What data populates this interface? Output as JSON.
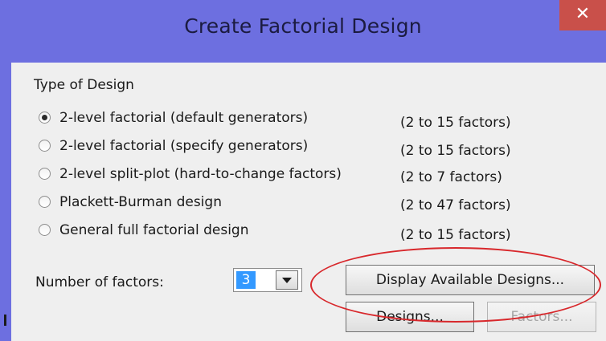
{
  "window": {
    "title": "Create Factorial Design",
    "close_glyph": "✕"
  },
  "design_type": {
    "label": "Type of Design",
    "options": [
      {
        "label": "2-level factorial (default generators)",
        "range": "(2 to 15 factors)",
        "selected": true
      },
      {
        "label": "2-level factorial (specify generators)",
        "range": "(2 to 15 factors)",
        "selected": false
      },
      {
        "label": "2-level split-plot (hard-to-change factors)",
        "range": "(2 to 7 factors)",
        "selected": false
      },
      {
        "label": "Plackett-Burman design",
        "range": "(2 to 47 factors)",
        "selected": false
      },
      {
        "label": "General full factorial design",
        "range": "(2 to 15 factors)",
        "selected": false
      }
    ]
  },
  "number_of_factors": {
    "label": "Number of factors:",
    "value": "3"
  },
  "buttons": {
    "display_available": "Display Available Designs...",
    "designs": "Designs...",
    "factors": "Factors..."
  },
  "colors": {
    "title_bar": "#6d6fe0",
    "close_button": "#c9504a",
    "annotation_ellipse": "#d8282c",
    "selection_highlight": "#3399ff"
  }
}
